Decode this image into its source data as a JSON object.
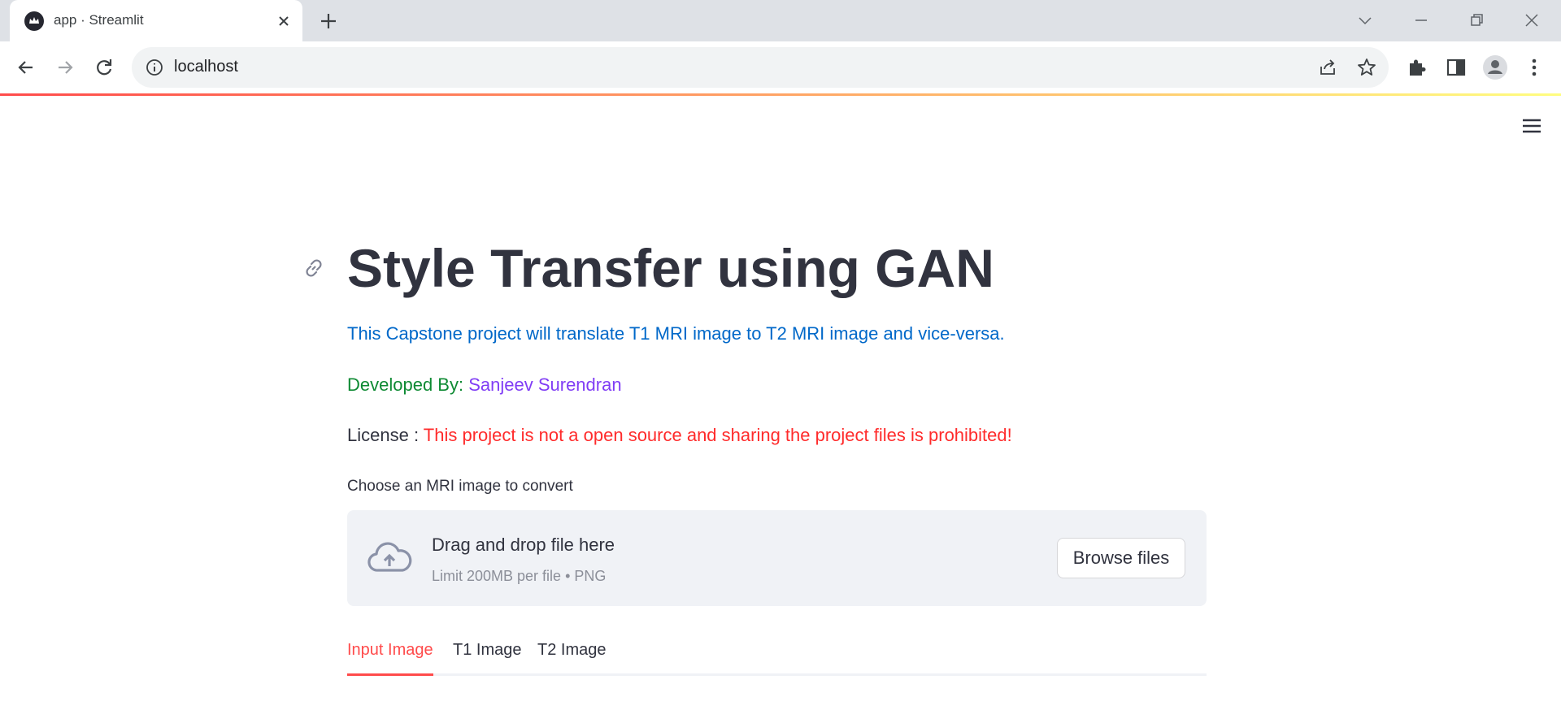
{
  "browser": {
    "tab_title": "app · Streamlit",
    "url": "localhost"
  },
  "page": {
    "title": "Style Transfer using GAN",
    "description": "This Capstone project will translate T1 MRI image to T2 MRI image and vice-versa.",
    "developed_by_label": "Developed By:",
    "developer_name": "Sanjeev Surendran",
    "license_label": "License :",
    "license_text": "This project is not a open source and sharing the project files is prohibited!",
    "uploader": {
      "label": "Choose an MRI image to convert",
      "drop_text": "Drag and drop file here",
      "limit_text": "Limit 200MB per file • PNG",
      "browse_label": "Browse files"
    },
    "tabs": [
      {
        "label": "Input Image",
        "active": true
      },
      {
        "label": "T1 Image",
        "active": false
      },
      {
        "label": "T2 Image",
        "active": false
      }
    ]
  },
  "colors": {
    "accent": "#ff4b4b",
    "link_blue": "#0068c9",
    "green": "#0e8a33",
    "violet": "#803df5",
    "red": "#ff2b2b"
  },
  "icons": [
    "streamlit-favicon-icon",
    "close-icon",
    "plus-icon",
    "chevron-down-icon",
    "minimize-icon",
    "restore-icon",
    "close-window-icon",
    "back-arrow-icon",
    "forward-arrow-icon",
    "reload-icon",
    "info-icon",
    "share-icon",
    "star-icon",
    "extensions-icon",
    "side-panel-icon",
    "profile-icon",
    "kebab-menu-icon",
    "hamburger-menu-icon",
    "link-icon",
    "cloud-upload-icon"
  ]
}
